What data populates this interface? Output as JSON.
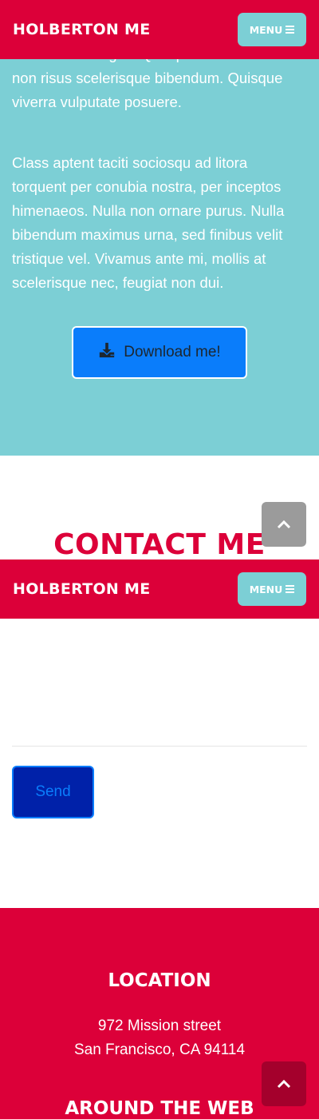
{
  "navbar": {
    "brand": "HOLBERTON ME",
    "menu_label": "MENU"
  },
  "about": {
    "paragraph_1": "malesuada feugiat. Quisque malesuada orci non risus scelerisque bibendum. Quisque viverra vulputate posuere.",
    "paragraph_2": "Class aptent taciti sociosqu ad litora torquent per conubia nostra, per inceptos himenaeos. Nulla non ornare purus. Nulla bibendum maximus urna, sed finibus velit tristique vel. Vivamus ante mi, mollis at scelerisque nec, feugiat non dui.",
    "download_label": "Download me!"
  },
  "contact": {
    "title": "CONTACT ME",
    "send_label": "Send"
  },
  "footer": {
    "location_title": "LOCATION",
    "address_line_1": "972 Mission street",
    "address_line_2": "San Francisco, CA 94114",
    "web_title": "AROUND THE WEB"
  },
  "icons": {
    "menu": "bars-icon",
    "download": "download-icon",
    "scroll_top": "chevron-up-icon"
  },
  "colors": {
    "brand_red": "#dc0039",
    "teal": "#7ccfd5",
    "blue": "#0a7dfb",
    "send_bg": "#0021a9"
  }
}
